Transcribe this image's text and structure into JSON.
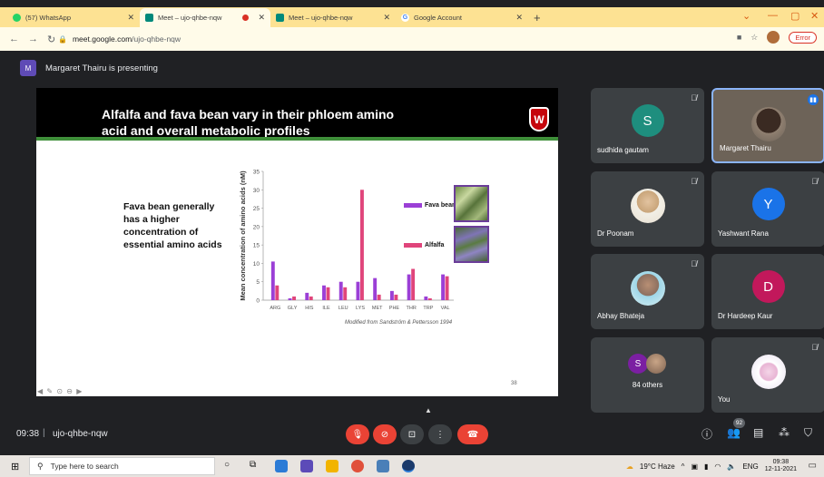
{
  "browser": {
    "tabs": [
      {
        "label": "(57) WhatsApp",
        "favicon_color": "#25d366",
        "active": false,
        "recording": false
      },
      {
        "label": "Meet – ujo-qhbe-nqw",
        "favicon_color": "#00897b",
        "active": true,
        "recording": true
      },
      {
        "label": "Meet – ujo-qhbe-nqw",
        "favicon_color": "#00897b",
        "active": false,
        "recording": false
      },
      {
        "label": "Google Account",
        "favicon_color": "#4285f4",
        "active": false,
        "recording": false
      }
    ],
    "url": {
      "domain": "meet.google.com",
      "path": "/ujo-qhbe-nqw"
    },
    "error_label": "Error"
  },
  "meet": {
    "presenter_initial": "M",
    "presenting_text": "Margaret Thairu is presenting",
    "meeting_time": "09:38",
    "meeting_code": "ujo-qhbe-nqw",
    "participant_count": "92"
  },
  "slide": {
    "title_line1": "Alfalfa and fava bean vary in their phloem amino",
    "title_line2": "acid and overall metabolic profiles",
    "crest_letter": "W",
    "body_text": "Fava bean generally has a higher concentration of essential amino acids",
    "credit": "Modified from Sandström & Pettersson 1994",
    "page_number": "38"
  },
  "chart_data": {
    "type": "bar",
    "ylabel": "Mean concentration of amino acids (nM)",
    "ylim": [
      0,
      35
    ],
    "yticks": [
      0,
      5,
      10,
      15,
      20,
      25,
      30,
      35
    ],
    "categories": [
      "ARG",
      "GLY",
      "HIS",
      "ILE",
      "LEU",
      "LYS",
      "MET",
      "PHE",
      "THR",
      "TRP",
      "VAL"
    ],
    "series": [
      {
        "name": "Fava bean",
        "color": "#9b3fd6",
        "values": [
          10.5,
          0.5,
          2,
          4,
          5,
          5,
          6,
          2.5,
          7,
          1,
          7
        ]
      },
      {
        "name": "Alfalfa",
        "color": "#e0457b",
        "values": [
          4,
          1,
          1,
          3.5,
          3.5,
          30,
          1.5,
          1.5,
          8.5,
          0.5,
          6.5
        ]
      }
    ]
  },
  "participants": [
    {
      "name": "sudhida gautam",
      "initial": "S",
      "avatar_color": "#1e8e7e",
      "muted": true,
      "type": "letter"
    },
    {
      "name": "Margaret Thairu",
      "initial": "",
      "avatar_color": "#6d6358",
      "muted": false,
      "type": "video",
      "speaking": true
    },
    {
      "name": "Dr Poonam",
      "initial": "",
      "avatar_color": "#c9a57a",
      "muted": true,
      "type": "photo"
    },
    {
      "name": "Yashwant Rana",
      "initial": "Y",
      "avatar_color": "#1a73e8",
      "muted": true,
      "type": "letter"
    },
    {
      "name": "Abhay Bhateja",
      "initial": "",
      "avatar_color": "#8d7060",
      "muted": true,
      "type": "photo"
    },
    {
      "name": "Dr Hardeep Kaur",
      "initial": "D",
      "avatar_color": "#c2185b",
      "muted": true,
      "type": "letter"
    },
    {
      "name": "84 others",
      "initial": "S",
      "avatar_color": "#7b1fa2",
      "muted": false,
      "type": "others"
    },
    {
      "name": "You",
      "initial": "",
      "avatar_color": "#e8e0f0",
      "muted": true,
      "type": "photo"
    }
  ],
  "taskbar": {
    "search_placeholder": "Type here to search",
    "weather": "19°C Haze",
    "language": "ENG",
    "time": "09:38",
    "date": "12-11-2021"
  }
}
